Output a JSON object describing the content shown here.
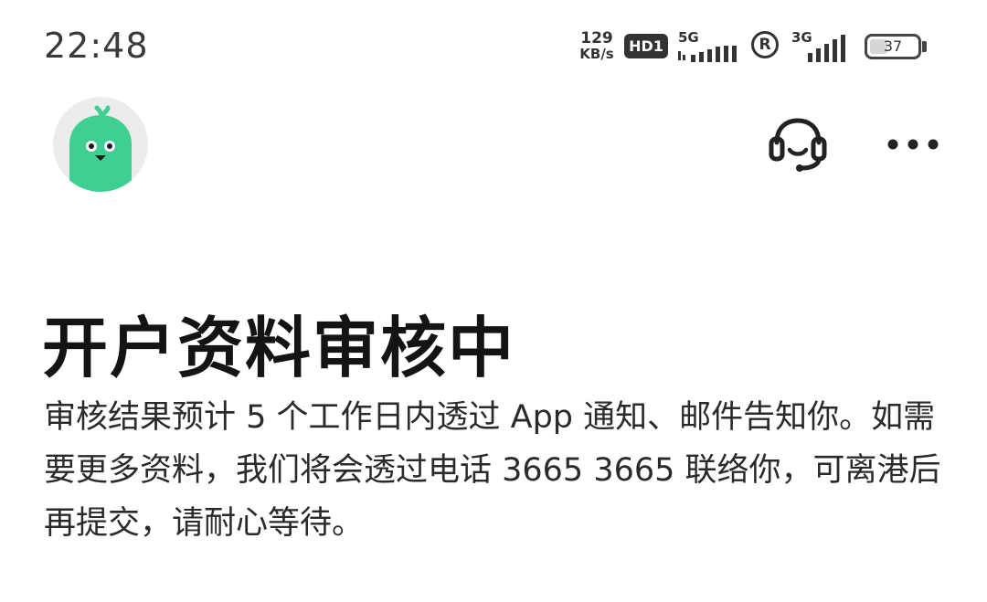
{
  "status_bar": {
    "time": "22:48",
    "net_speed_value": "129",
    "net_speed_unit": "KB/s",
    "hd_badge": "HD1",
    "sim1_network": "5G",
    "sim2_network": "3G",
    "roaming_icon_label": "R",
    "battery_percent": "37",
    "battery_level": 0.37
  },
  "header": {
    "avatar_icon": "green-mascot-icon",
    "support_icon": "headset-icon",
    "more_icon": "more-horizontal-icon"
  },
  "content": {
    "title": "开户资料审核中",
    "body": "审核结果预计 5 个工作日内透过 App 通知、邮件告知你。如需要更多资料，我们将会透过电话 3665 3665 联络你，可离港后再提交，请耐心等待。"
  },
  "colors": {
    "mascot": "#3fcf93",
    "avatar_bg": "#ececec",
    "title": "#141414",
    "body": "#2a2a2a",
    "icon": "#222222"
  }
}
